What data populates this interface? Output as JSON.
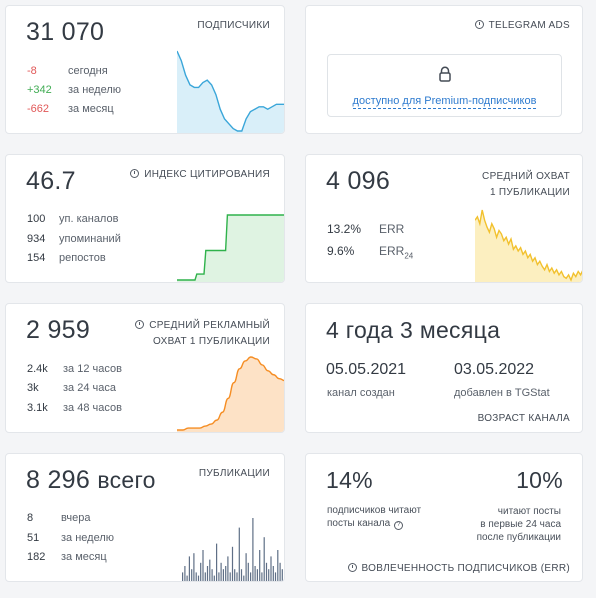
{
  "colors": {
    "blue": "#3aa6d9",
    "blue_fill": "#d9eff9",
    "green": "#2fb24b",
    "green_fill": "#dff3e2",
    "yellow": "#f2c12e",
    "yellow_fill": "#fcefc0",
    "orange": "#f58d23",
    "orange_fill": "#fde2c6",
    "slate": "#5f6f86",
    "negative": "#e15858",
    "positive": "#42ad55",
    "link": "#2e7bcf"
  },
  "subscribers": {
    "value": "31 070",
    "label": "ПОДПИСЧИКИ",
    "rows": [
      {
        "value": "-8",
        "label": "сегодня",
        "sign": "neg"
      },
      {
        "value": "+342",
        "label": "за неделю",
        "sign": "pos"
      },
      {
        "value": "-662",
        "label": "за месяц",
        "sign": "neg"
      }
    ],
    "sparkline": [
      48,
      44,
      38,
      34,
      33,
      33,
      35,
      36,
      34,
      30,
      24,
      20,
      18,
      16,
      15,
      15,
      20,
      23,
      24,
      25,
      25,
      24,
      25,
      26,
      26,
      26
    ]
  },
  "ads": {
    "label": "TELEGRAM ADS",
    "icon": "lock-icon",
    "link": "доступно для Premium-подписчиков"
  },
  "citation": {
    "value": "46.7",
    "label": "ИНДЕКС ЦИТИРОВАНИЯ",
    "rows": [
      {
        "value": "100",
        "label": "уп. каналов"
      },
      {
        "value": "934",
        "label": "упоминаний"
      },
      {
        "value": "154",
        "label": "репостов"
      }
    ],
    "sparkline": [
      0,
      0,
      0,
      0,
      0,
      0,
      0,
      0,
      0,
      0,
      0,
      1,
      1,
      1,
      1,
      1,
      5,
      5,
      5,
      5,
      5,
      5,
      5,
      5,
      5,
      5,
      5,
      5,
      11,
      11,
      11,
      11,
      11,
      11,
      11,
      11,
      11,
      11,
      11,
      11,
      11,
      11,
      11,
      11,
      11,
      11,
      11,
      11,
      11,
      11,
      11,
      11,
      11,
      11,
      11,
      11,
      11,
      11,
      11,
      11,
      11
    ]
  },
  "reach": {
    "value": "4 096",
    "label_line1": "СРЕДНИЙ ОХВАТ",
    "label_line2": "1 ПУБЛИКАЦИИ",
    "rows": [
      {
        "value": "13.2%",
        "label": "ERR",
        "sub": ""
      },
      {
        "value": "9.6%",
        "label": "ERR",
        "sub": "24"
      }
    ],
    "sparkline": [
      62,
      64,
      60,
      68,
      62,
      58,
      55,
      60,
      57,
      52,
      56,
      54,
      50,
      52,
      48,
      51,
      45,
      47,
      44,
      46,
      42,
      44,
      40,
      42,
      38,
      40,
      36,
      38,
      35,
      33,
      36,
      32,
      34,
      31,
      33,
      30,
      32,
      29,
      28,
      30,
      27,
      31,
      29,
      32,
      30,
      33
    ]
  },
  "ad_reach": {
    "value": "2 959",
    "label_line1": "СРЕДНИЙ РЕКЛАМНЫЙ",
    "label_line2": "ОХВАТ 1 ПУБЛИКАЦИИ",
    "rows": [
      {
        "value": "2.4k",
        "label": "за 12 часов"
      },
      {
        "value": "3k",
        "label": "за 24 часа"
      },
      {
        "value": "3.1k",
        "label": "за 48 часов"
      }
    ],
    "sparkline": [
      0,
      0,
      1,
      1,
      1,
      2,
      3,
      5,
      9,
      16,
      24,
      31,
      35,
      37,
      36,
      33,
      30,
      28,
      26,
      25
    ]
  },
  "age": {
    "value": "4 года 3 месяца",
    "created_date": "05.05.2021",
    "created_label": "канал создан",
    "added_date": "03.05.2022",
    "added_label": "добавлен в TGStat",
    "label": "ВОЗРАСТ КАНАЛА"
  },
  "publications": {
    "value": "8 296",
    "suffix": "всего",
    "label": "ПУБЛИКАЦИИ",
    "rows": [
      {
        "value": "8",
        "label": "вчера"
      },
      {
        "value": "51",
        "label": "за неделю"
      },
      {
        "value": "182",
        "label": "за месяц"
      }
    ],
    "bars": [
      3,
      5,
      2,
      8,
      4,
      9,
      3,
      2,
      6,
      10,
      3,
      5,
      7,
      4,
      2,
      12,
      3,
      6,
      4,
      5,
      8,
      3,
      11,
      4,
      3,
      17,
      4,
      2,
      9,
      6,
      3,
      20,
      5,
      4,
      10,
      3,
      14,
      6,
      4,
      8,
      5,
      3,
      10,
      6,
      4
    ]
  },
  "engagement": {
    "percent_left": "14%",
    "text_left_1": "подписчиков читают",
    "text_left_2": "посты канала",
    "percent_right": "10%",
    "text_right_1": "читают посты",
    "text_right_2": "в первые 24 часа",
    "text_right_3": "после публикации",
    "label": "ВОВЛЕЧЕННОСТЬ ПОДПИСЧИКОВ (ERR)"
  }
}
